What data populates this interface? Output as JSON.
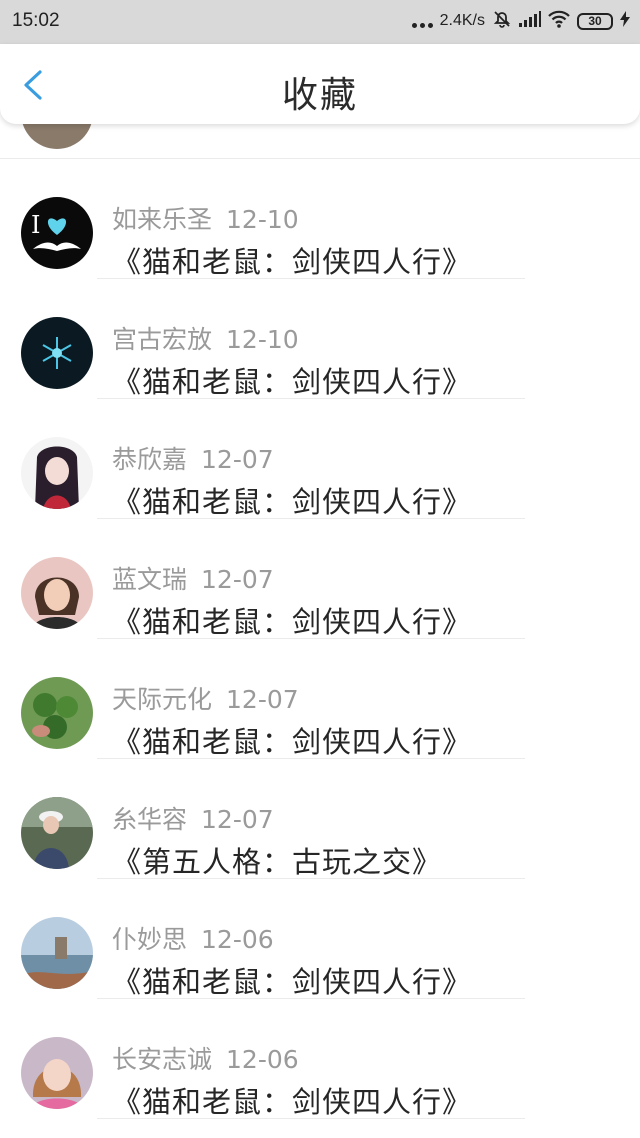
{
  "status_bar": {
    "time": "15:02",
    "network_speed": "2.4K/s",
    "battery": "30"
  },
  "header": {
    "title": "收藏",
    "back_icon": "chevron-left-icon",
    "accent_color": "#3a9de0"
  },
  "items": [
    {
      "name": "如来乐圣",
      "time": "12-10",
      "title": "《猫和老鼠：剑侠四人行》"
    },
    {
      "name": "宫古宏放",
      "time": "12-10",
      "title": "《猫和老鼠：剑侠四人行》"
    },
    {
      "name": "恭欣嘉",
      "time": "12-07",
      "title": "《猫和老鼠：剑侠四人行》"
    },
    {
      "name": "蓝文瑞",
      "time": "12-07",
      "title": "《猫和老鼠：剑侠四人行》"
    },
    {
      "name": "天际元化",
      "time": "12-07",
      "title": "《猫和老鼠：剑侠四人行》"
    },
    {
      "name": "糸华容",
      "time": "12-07",
      "title": "《第五人格：古玩之交》"
    },
    {
      "name": "仆妙思",
      "time": "12-06",
      "title": "《猫和老鼠：剑侠四人行》"
    },
    {
      "name": "长安志诚",
      "time": "12-06",
      "title": "《猫和老鼠：剑侠四人行》"
    }
  ]
}
